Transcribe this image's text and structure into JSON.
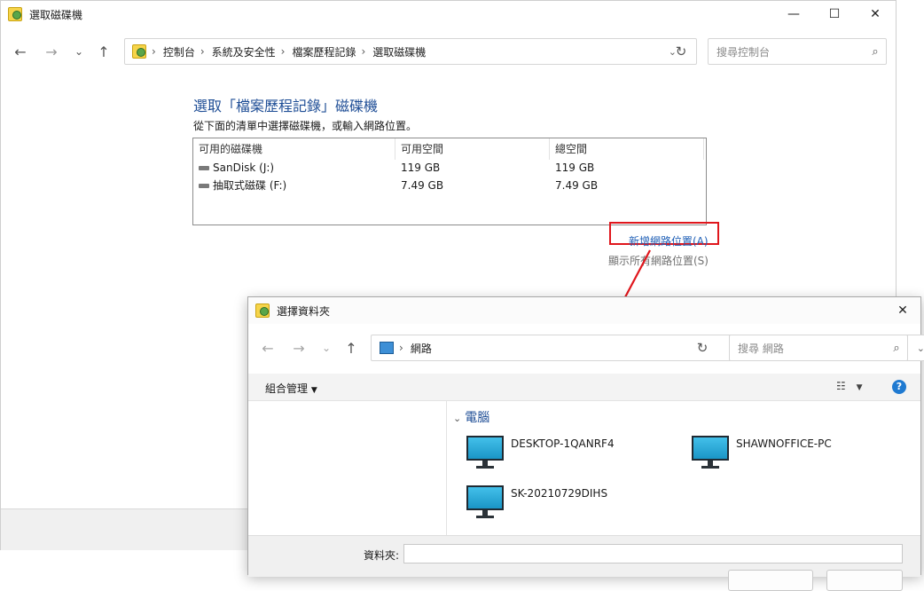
{
  "main_window": {
    "title": "選取磁碟機",
    "controls": {
      "minimize": "—",
      "maximize": "☐",
      "close": "✕"
    },
    "nav": {
      "back": "←",
      "forward": "→",
      "recent": "⌄",
      "up": "↑"
    },
    "breadcrumb": [
      "控制台",
      "系統及安全性",
      "檔案歷程記錄",
      "選取磁碟機"
    ],
    "search_placeholder": "搜尋控制台",
    "heading": "選取「檔案歷程記錄」磁碟機",
    "instruction": "從下面的清單中選擇磁碟機，或輸入網路位置。",
    "drive_table": {
      "columns": [
        "可用的磁碟機",
        "可用空間",
        "總空間"
      ],
      "rows": [
        {
          "name": "SanDisk (J:)",
          "free": "119 GB",
          "total": "119 GB"
        },
        {
          "name": "抽取式磁碟 (F:)",
          "free": "7.49 GB",
          "total": "7.49 GB"
        }
      ]
    },
    "add_network_link": "新增網路位置(A)",
    "show_network_link": "顯示所有網路位置(S)"
  },
  "folder_dialog": {
    "title": "選擇資料夾",
    "close": "✕",
    "breadcrumb": [
      "網路"
    ],
    "search_placeholder": "搜尋 網路",
    "organize_label": "組合管理",
    "group_label": "電腦",
    "computers": [
      "DESKTOP-1QANRF4",
      "SHAWNOFFICE-PC",
      "SK-20210729DIHS"
    ],
    "folder_label": "資料夾:",
    "folder_value": ""
  },
  "colors": {
    "accent": "#1f4e96",
    "link": "#1f5fb6",
    "highlight": "#e0161c"
  }
}
